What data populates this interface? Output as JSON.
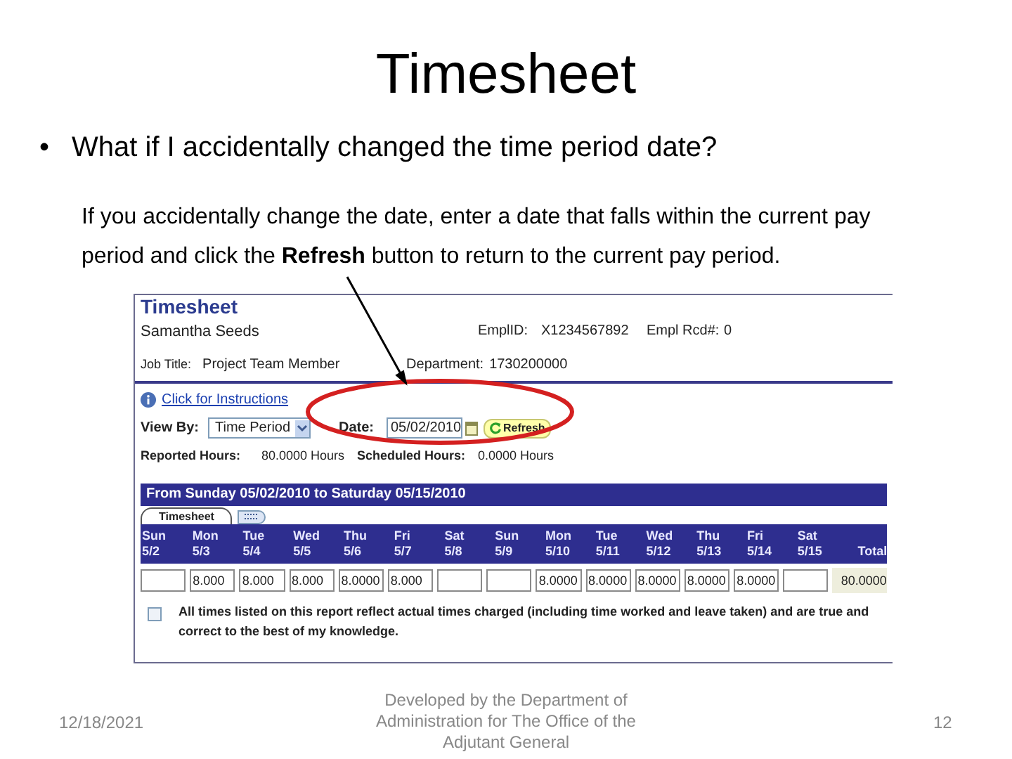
{
  "slide": {
    "title": "Timesheet",
    "bullet": "•",
    "question": "What if I accidentally changed the time period date?",
    "note": "If you accidentally change the date, enter a date that falls within the current pay period and click the **Refresh** button to return to the current pay period."
  },
  "timesheet": {
    "heading": "Timesheet",
    "employee": "Samantha Seeds",
    "empl_id_label": "EmplID:",
    "empl_id": "X1234567892",
    "empl_rcd_label": "Empl Rcd#:",
    "empl_rcd": "0",
    "job_title_label": "Job Title:",
    "job_title": "Project Team Member",
    "department_label": "Department:",
    "department": "1730200000",
    "instructions_link": "Click for Instructions",
    "view_by_label": "View By:",
    "view_by": "Time Period",
    "date_label": "Date:",
    "date": "05/02/2010",
    "refresh_button": "Refresh",
    "reported_label": "Reported Hours:",
    "reported": "80.0000 Hours",
    "scheduled_label": "Scheduled Hours:",
    "scheduled": "0.0000 Hours",
    "period": "From Sunday 05/02/2010 to Saturday 05/15/2010",
    "tabs": [
      {
        "kind": "text",
        "label": "Timesheet",
        "selected": true
      },
      {
        "kind": "icon",
        "selected": false
      }
    ],
    "days": [
      {
        "day": "Sun",
        "date": "5/2"
      },
      {
        "day": "Mon",
        "date": "5/3",
        "hours": "8.000"
      },
      {
        "day": "Tue",
        "date": "5/4",
        "hours": "8.000"
      },
      {
        "day": "Wed",
        "date": "5/5",
        "hours": "8.000"
      },
      {
        "day": "Thu",
        "date": "5/6",
        "hours": "8.0000"
      },
      {
        "day": "Fri",
        "date": "5/7",
        "hours": "8.000"
      },
      {
        "day": "Sat",
        "date": "5/8"
      },
      {
        "day": "Sun",
        "date": "5/9"
      },
      {
        "day": "Mon",
        "date": "5/10",
        "hours": "8.0000"
      },
      {
        "day": "Tue",
        "date": "5/11",
        "hours": "8.0000"
      },
      {
        "day": "Wed",
        "date": "5/12",
        "hours": "8.0000"
      },
      {
        "day": "Thu",
        "date": "5/13",
        "hours": "8.0000"
      },
      {
        "day": "Fri",
        "date": "5/14",
        "hours": "8.0000"
      },
      {
        "day": "Sat",
        "date": "5/15"
      }
    ],
    "total_label": "Total",
    "total": "80.0000",
    "attestation": {
      "checked": false,
      "text": "All times listed on this report reflect actual times charged (including time worked and leave taken) and are true and correct to the best of my knowledge."
    }
  },
  "footer": {
    "date": "12/18/2021",
    "credit": "Developed by the Department of Administration for The Office of the Adjutant General",
    "page": "12"
  }
}
